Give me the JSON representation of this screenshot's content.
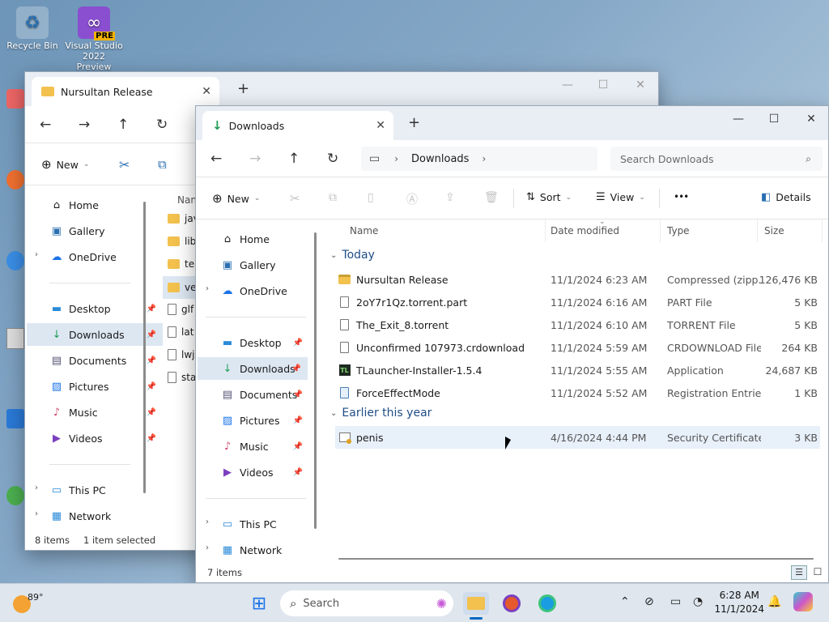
{
  "desktop": {
    "icons": [
      {
        "label": "Recycle Bin"
      },
      {
        "label": "Visual Studio 2022 Preview"
      },
      {
        "label": "PRE"
      }
    ]
  },
  "back_window": {
    "tab_title": "Nursultan Release",
    "cmd_new": "New",
    "nav": [
      "Home",
      "Gallery",
      "OneDrive",
      "Desktop",
      "Downloads",
      "Documents",
      "Pictures",
      "Music",
      "Videos",
      "This PC",
      "Network"
    ],
    "col_name": "Nan",
    "files": [
      "jav",
      "libr",
      "ter",
      "ver",
      "glf",
      "lat",
      "lwj",
      "sta"
    ],
    "status_items": "8 items",
    "status_selected": "1 item selected"
  },
  "front_window": {
    "tab_title": "Downloads",
    "breadcrumb": "Downloads",
    "search_placeholder": "Search Downloads",
    "cmd": {
      "new": "New",
      "sort": "Sort",
      "view": "View",
      "more": "•••",
      "details": "Details"
    },
    "nav": [
      "Home",
      "Gallery",
      "OneDrive",
      "Desktop",
      "Downloads",
      "Documents",
      "Pictures",
      "Music",
      "Videos",
      "This PC",
      "Network"
    ],
    "columns": {
      "name": "Name",
      "date": "Date modified",
      "type": "Type",
      "size": "Size"
    },
    "groups": [
      {
        "label": "Today",
        "files": [
          {
            "name": "Nursultan Release",
            "date": "11/1/2024 6:23 AM",
            "type": "Compressed (zipp...",
            "size": "126,476 KB"
          },
          {
            "name": "2oY7r1Qz.torrent.part",
            "date": "11/1/2024 6:16 AM",
            "type": "PART File",
            "size": "5 KB"
          },
          {
            "name": "The_Exit_8.torrent",
            "date": "11/1/2024 6:10 AM",
            "type": "TORRENT File",
            "size": "5 KB"
          },
          {
            "name": "Unconfirmed 107973.crdownload",
            "date": "11/1/2024 5:59 AM",
            "type": "CRDOWNLOAD File",
            "size": "264 KB"
          },
          {
            "name": "TLauncher-Installer-1.5.4",
            "date": "11/1/2024 5:55 AM",
            "type": "Application",
            "size": "24,687 KB"
          },
          {
            "name": "ForceEffectMode",
            "date": "11/1/2024 5:52 AM",
            "type": "Registration Entries",
            "size": "1 KB"
          }
        ]
      },
      {
        "label": "Earlier this year",
        "files": [
          {
            "name": "penis",
            "date": "4/16/2024 4:44 PM",
            "type": "Security Certificate",
            "size": "3 KB"
          }
        ]
      }
    ],
    "status_items": "7 items"
  },
  "taskbar": {
    "weather": "89°",
    "search": "Search",
    "time": "6:28 AM",
    "date": "11/1/2024"
  },
  "colors": {
    "accent": "#0067c0",
    "selection": "#dde7f2",
    "folder": "#f2c14e"
  }
}
